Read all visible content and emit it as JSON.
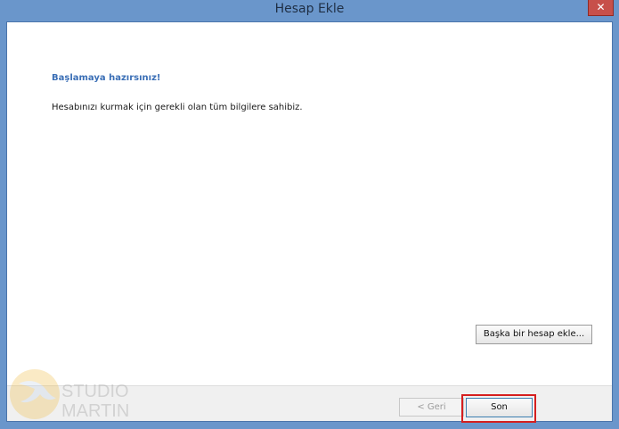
{
  "window": {
    "title": "Hesap Ekle",
    "close_label": "✕"
  },
  "main": {
    "heading": "Başlamaya hazırsınız!",
    "description": "Hesabınızı kurmak için gerekli olan tüm bilgilere sahibiz.",
    "add_account_button": "Başka bir hesap ekle..."
  },
  "footer": {
    "back_button": "< Geri",
    "finish_button": "Son"
  },
  "watermark": {
    "line1": "STUDIO",
    "line2": "MARTIN"
  },
  "colors": {
    "titlebar": "#6a96cb",
    "heading": "#3b6fb6",
    "highlight": "#d51f1f"
  }
}
